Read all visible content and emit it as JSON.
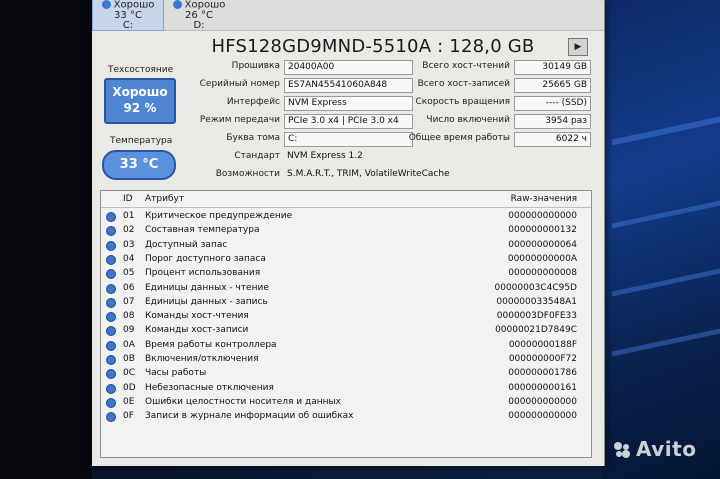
{
  "drives": [
    {
      "status": "Хорошо",
      "temp": "33 °C",
      "letter": "C:"
    },
    {
      "status": "Хорошо",
      "temp": "26 °C",
      "letter": "D:"
    }
  ],
  "title": "HFS128GD9MND-5510A : 128,0 GB",
  "left": {
    "health_label": "Техсостояние",
    "health_status": "Хорошо",
    "health_percent": "92 %",
    "temp_label": "Температура",
    "temp_value": "33 °C"
  },
  "info": [
    {
      "label": "Прошивка",
      "value": "20400A00"
    },
    {
      "label": "Серийный номер",
      "value": "ES7AN45541060A848"
    },
    {
      "label": "Интерфейс",
      "value": "NVM Express"
    },
    {
      "label": "Режим передачи",
      "value": "PCIe 3.0 x4 | PCIe 3.0 x4"
    },
    {
      "label": "Буква тома",
      "value": "C:"
    },
    {
      "label": "Стандарт",
      "value": "NVM Express 1.2"
    },
    {
      "label": "Возможности",
      "value": "S.M.A.R.T., TRIM, VolatileWriteCache"
    }
  ],
  "stats": [
    {
      "label": "Всего хост-чтений",
      "value": "30149 GB"
    },
    {
      "label": "Всего хост-записей",
      "value": "25665 GB"
    },
    {
      "label": "Скорость вращения",
      "value": "---- (SSD)"
    },
    {
      "label": "Число включений",
      "value": "3954 раз"
    },
    {
      "label": "Общее время работы",
      "value": "6022 ч"
    }
  ],
  "table": {
    "col_id": "ID",
    "col_attr": "Атрибут",
    "col_raw": "Raw-значения",
    "rows": [
      {
        "id": "01",
        "attr": "Критическое предупреждение",
        "raw": "000000000000"
      },
      {
        "id": "02",
        "attr": "Составная температура",
        "raw": "000000000132"
      },
      {
        "id": "03",
        "attr": "Доступный запас",
        "raw": "000000000064"
      },
      {
        "id": "04",
        "attr": "Порог доступного запаса",
        "raw": "00000000000A"
      },
      {
        "id": "05",
        "attr": "Процент использования",
        "raw": "000000000008"
      },
      {
        "id": "06",
        "attr": "Единицы данных - чтение",
        "raw": "00000003C4C95D"
      },
      {
        "id": "07",
        "attr": "Единицы данных - запись",
        "raw": "000000033548A1"
      },
      {
        "id": "08",
        "attr": "Команды хост-чтения",
        "raw": "0000003DF0FE33"
      },
      {
        "id": "09",
        "attr": "Команды хост-записи",
        "raw": "00000021D7849C"
      },
      {
        "id": "0A",
        "attr": "Время работы контроллера",
        "raw": "00000000188F"
      },
      {
        "id": "0B",
        "attr": "Включения/отключения",
        "raw": "000000000F72"
      },
      {
        "id": "0C",
        "attr": "Часы работы",
        "raw": "000000001786"
      },
      {
        "id": "0D",
        "attr": "Небезопасные отключения",
        "raw": "000000000161"
      },
      {
        "id": "0E",
        "attr": "Ошибки целостности носителя и данных",
        "raw": "000000000000"
      },
      {
        "id": "0F",
        "attr": "Записи в журнале информации об ошибках",
        "raw": "000000000000"
      }
    ]
  },
  "watermark": "Avito"
}
